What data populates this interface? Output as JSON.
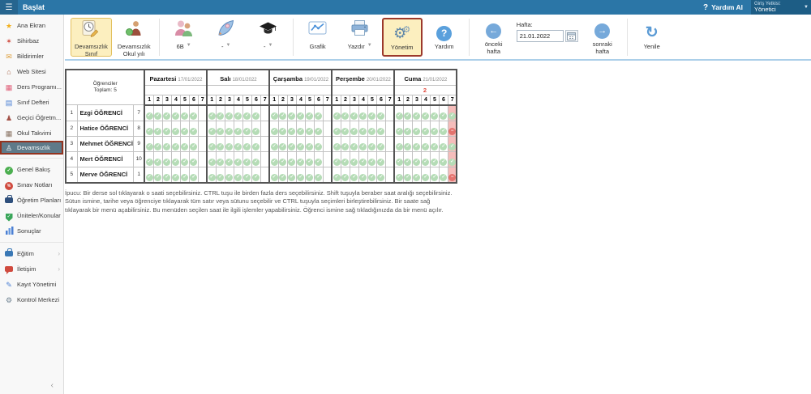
{
  "topbar": {
    "menu_label": "Başlat",
    "help_label": "Yardım Al",
    "role_label": "Giriş Yetkisi:",
    "role_value": "Yönetici",
    "bar_color": "#2b76a7"
  },
  "sidebar": {
    "groups": [
      [
        {
          "label": "Ana Ekran",
          "icon": "star-icon",
          "color": "#f2b01e"
        },
        {
          "label": "Sihirbaz",
          "icon": "wand-icon",
          "color": "#cf4a3e"
        },
        {
          "label": "Bildirimler",
          "icon": "mail-icon",
          "color": "#dd9f3d"
        },
        {
          "label": "Web Sitesi",
          "icon": "home-icon",
          "color": "#a8674a"
        },
        {
          "label": "Ders Programı...",
          "icon": "schedule-grid-icon",
          "color": "#e0607a"
        },
        {
          "label": "Sınıf Defteri",
          "icon": "class-book-icon",
          "color": "#4a7fd4"
        },
        {
          "label": "Geçici Öğretm...",
          "icon": "temp-teacher-icon",
          "color": "#a35248"
        },
        {
          "label": "Okul Takvimi",
          "icon": "school-calendar-icon",
          "color": "#8a7464"
        },
        {
          "label": "Devamsızlık",
          "icon": "person-icon",
          "color": "#ffffff",
          "selected": true
        }
      ],
      [
        {
          "label": "Genel Bakış",
          "icon": "check-circle-icon",
          "color": "#4caf50"
        },
        {
          "label": "Sınav Notları",
          "icon": "red-circle-icon",
          "color": "#d04a3e"
        },
        {
          "label": "Öğretim Planları",
          "icon": "briefcase-icon",
          "color": "#2e4f7c"
        },
        {
          "label": "Üniteler/Konular",
          "icon": "shield-icon",
          "color": "#3aa65a"
        },
        {
          "label": "Sonuçlar",
          "icon": "bars-icon",
          "color": "#4a7fd4"
        }
      ],
      [
        {
          "label": "Eğitim",
          "icon": "briefcase-icon",
          "color": "#3a78b5",
          "chevron": true
        },
        {
          "label": "İletişim",
          "icon": "chat-icon",
          "color": "#d04a3e",
          "chevron": true
        },
        {
          "label": "Kayıt Yönetimi",
          "icon": "pencil-icon",
          "color": "#4a7fd4"
        },
        {
          "label": "Kontrol Merkezi",
          "icon": "gear-icon",
          "color": "#6b7f8f"
        }
      ]
    ]
  },
  "toolbar": {
    "groups": [
      [
        {
          "label": "Devamsızlık\nSınıf",
          "icon": "attendance-class-icon",
          "state": "selected"
        },
        {
          "label": "Devamsızlık\nOkul yılı",
          "icon": "attendance-schoolyear-icon"
        }
      ],
      [
        {
          "label": "6B",
          "icon": "students-icon",
          "dropdown": true
        },
        {
          "label": "-",
          "icon": "rocket-icon",
          "dropdown": true
        },
        {
          "label": "-",
          "icon": "graduation-cap-icon",
          "dropdown": true
        }
      ],
      [
        {
          "label": "Grafik",
          "icon": "chart-icon"
        },
        {
          "label": "Yazdır",
          "icon": "printer-icon",
          "dropdown": true
        },
        {
          "label": "Yönetim",
          "icon": "gears-icon",
          "state": "managed"
        },
        {
          "label": "Yardım",
          "icon": "help-icon"
        }
      ]
    ],
    "week": {
      "prev_label": "önceki\nhafta",
      "field_label": "Hafta:",
      "date_value": "21.01.2022",
      "next_label": "sonraki\nhafta"
    },
    "refresh_label": "Yenile",
    "highlight_bg": "#fcefbf",
    "managed_border": "#9c392b"
  },
  "attendance": {
    "corner": {
      "line1": "Öğrenciler",
      "line2": "Toplam: 5"
    },
    "days": [
      {
        "name": "Pazartesi",
        "date": "17/01/2022"
      },
      {
        "name": "Salı",
        "date": "18/01/2022"
      },
      {
        "name": "Çarşamba",
        "date": "19/01/2022"
      },
      {
        "name": "Perşembe",
        "date": "20/01/2022"
      },
      {
        "name": "Cuma",
        "date": "21/01/2022"
      }
    ],
    "hours": [
      "1",
      "2",
      "3",
      "4",
      "5",
      "6",
      "7"
    ],
    "absence_count": {
      "day_index": 4,
      "value": "2",
      "color": "#e04b3f"
    },
    "highlight_column": {
      "day_index": 4,
      "hour_index": 6,
      "bg": "#f5bdbb"
    },
    "cell_legend": {
      "P": "present",
      "A": "absent",
      ".": "no-lesson"
    },
    "present_color": "#b5dcb6",
    "absent_color": "#e4736e",
    "rows": [
      {
        "no": "1",
        "name": "Ezgi ÖĞRENCİ",
        "number": "7",
        "days": [
          "PPPPPP.",
          "PPPPPP.",
          "PPPPPP.",
          "PPPPPP.",
          "PPPPPPP"
        ]
      },
      {
        "no": "2",
        "name": "Hatice ÖĞRENCİ",
        "number": "8",
        "days": [
          "PPPPPP.",
          "PPPPPP.",
          "PPPPPP.",
          "PPPPPP.",
          "PPPPPPA"
        ]
      },
      {
        "no": "3",
        "name": "Mehmet ÖĞRENCİ",
        "number": "9",
        "days": [
          "PPPPPP.",
          "PPPPPP.",
          "PPPPPP.",
          "PPPPPP.",
          "PPPPPPP"
        ]
      },
      {
        "no": "4",
        "name": "Mert ÖĞRENCİ",
        "number": "10",
        "days": [
          "PPPPPP.",
          "PPPPPP.",
          "PPPPPP.",
          "PPPPPP.",
          "PPPPPPP"
        ]
      },
      {
        "no": "5",
        "name": "Merve ÖĞRENCİ",
        "number": "1",
        "days": [
          "PPPPPP.",
          "PPPPPP.",
          "PPPPPP.",
          "PPPPPP.",
          "PPPPPPA"
        ]
      }
    ]
  },
  "footer": {
    "tip": "İpucu: Bir derse sol tıklayarak o saati seçebilirsiniz. CTRL tuşu ile birden fazla ders seçebilirsiniz. Shift tuşuyla beraber saat aralığı seçebilirsiniz. Sütun ismine, tarihe veya öğrenciye tıklayarak tüm satır veya sütunu seçebilir ve CTRL tuşuyla seçimleri birleştirebilirsiniz. Bir saate sağ tıklayarak bir menü açabilirsiniz. Bu menüden seçilen saat ile ilgili işlemler yapabilirsiniz. Öğrenci ismine sağ tıkladığınızda da bir menü açılır."
  }
}
